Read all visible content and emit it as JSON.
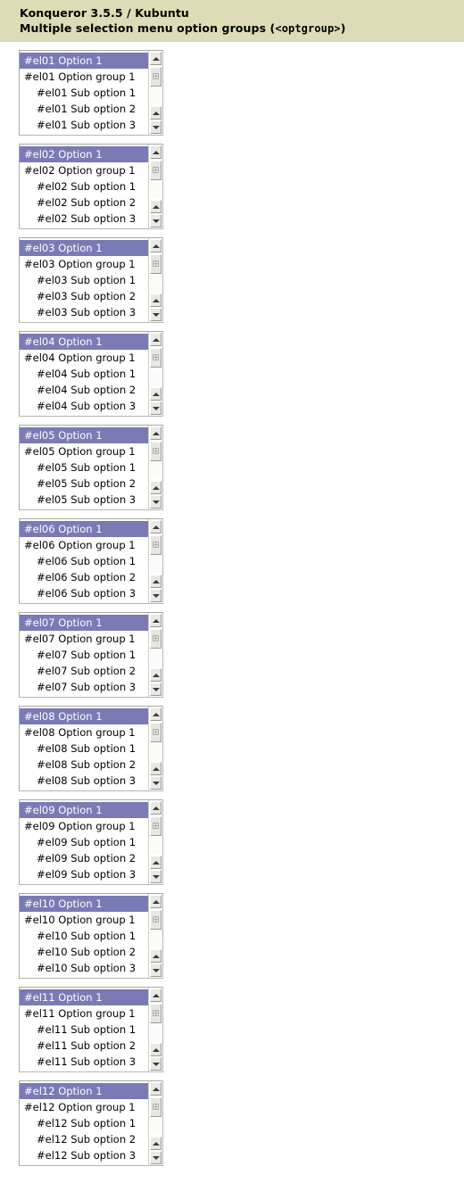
{
  "header": {
    "line1": "Konqueror 3.5.5 / Kubuntu",
    "line2_prefix": "Multiple selection menu option groups (",
    "line2_tag": "<optgroup>",
    "line2_suffix": ")",
    "background_color": "#dddcb6",
    "text_color": "#000000"
  },
  "colors": {
    "selection_background": "#7a7ab5",
    "selection_text": "#ffffff",
    "listbox_background": "#ffffff",
    "listbox_border": "#b5b5b0",
    "scrollbar_button": "#e8e8e4",
    "page_background": "#ffffff"
  },
  "scrollbar": {
    "up_arrow_icon": "triangle-up-icon",
    "down_arrow_icon": "triangle-down-icon",
    "thumb_grip_icon": "grip-dots-icon"
  },
  "listboxes": [
    {
      "id": "el01",
      "options": [
        {
          "label": "#el01 Option 1",
          "selected": true,
          "sub": false
        },
        {
          "label": "#el01 Option group 1",
          "selected": false,
          "sub": false
        },
        {
          "label": "#el01 Sub option 1",
          "selected": false,
          "sub": true
        },
        {
          "label": "#el01 Sub option 2",
          "selected": false,
          "sub": true
        },
        {
          "label": "#el01 Sub option 3",
          "selected": false,
          "sub": true
        }
      ]
    },
    {
      "id": "el02",
      "options": [
        {
          "label": "#el02 Option 1",
          "selected": true,
          "sub": false
        },
        {
          "label": "#el02 Option group 1",
          "selected": false,
          "sub": false
        },
        {
          "label": "#el02 Sub option 1",
          "selected": false,
          "sub": true
        },
        {
          "label": "#el02 Sub option 2",
          "selected": false,
          "sub": true
        },
        {
          "label": "#el02 Sub option 3",
          "selected": false,
          "sub": true
        }
      ]
    },
    {
      "id": "el03",
      "options": [
        {
          "label": "#el03 Option 1",
          "selected": true,
          "sub": false
        },
        {
          "label": "#el03 Option group 1",
          "selected": false,
          "sub": false
        },
        {
          "label": "#el03 Sub option 1",
          "selected": false,
          "sub": true
        },
        {
          "label": "#el03 Sub option 2",
          "selected": false,
          "sub": true
        },
        {
          "label": "#el03 Sub option 3",
          "selected": false,
          "sub": true
        }
      ]
    },
    {
      "id": "el04",
      "options": [
        {
          "label": "#el04 Option 1",
          "selected": true,
          "sub": false
        },
        {
          "label": "#el04 Option group 1",
          "selected": false,
          "sub": false
        },
        {
          "label": "#el04 Sub option 1",
          "selected": false,
          "sub": true
        },
        {
          "label": "#el04 Sub option 2",
          "selected": false,
          "sub": true
        },
        {
          "label": "#el04 Sub option 3",
          "selected": false,
          "sub": true
        }
      ]
    },
    {
      "id": "el05",
      "options": [
        {
          "label": "#el05 Option 1",
          "selected": true,
          "sub": false
        },
        {
          "label": "#el05 Option group 1",
          "selected": false,
          "sub": false
        },
        {
          "label": "#el05 Sub option 1",
          "selected": false,
          "sub": true
        },
        {
          "label": "#el05 Sub option 2",
          "selected": false,
          "sub": true
        },
        {
          "label": "#el05 Sub option 3",
          "selected": false,
          "sub": true
        }
      ]
    },
    {
      "id": "el06",
      "options": [
        {
          "label": "#el06 Option 1",
          "selected": true,
          "sub": false
        },
        {
          "label": "#el06 Option group 1",
          "selected": false,
          "sub": false
        },
        {
          "label": "#el06 Sub option 1",
          "selected": false,
          "sub": true
        },
        {
          "label": "#el06 Sub option 2",
          "selected": false,
          "sub": true
        },
        {
          "label": "#el06 Sub option 3",
          "selected": false,
          "sub": true
        }
      ]
    },
    {
      "id": "el07",
      "options": [
        {
          "label": "#el07 Option 1",
          "selected": true,
          "sub": false
        },
        {
          "label": "#el07 Option group 1",
          "selected": false,
          "sub": false
        },
        {
          "label": "#el07 Sub option 1",
          "selected": false,
          "sub": true
        },
        {
          "label": "#el07 Sub option 2",
          "selected": false,
          "sub": true
        },
        {
          "label": "#el07 Sub option 3",
          "selected": false,
          "sub": true
        }
      ]
    },
    {
      "id": "el08",
      "options": [
        {
          "label": "#el08 Option 1",
          "selected": true,
          "sub": false
        },
        {
          "label": "#el08 Option group 1",
          "selected": false,
          "sub": false
        },
        {
          "label": "#el08 Sub option 1",
          "selected": false,
          "sub": true
        },
        {
          "label": "#el08 Sub option 2",
          "selected": false,
          "sub": true
        },
        {
          "label": "#el08 Sub option 3",
          "selected": false,
          "sub": true
        }
      ]
    },
    {
      "id": "el09",
      "options": [
        {
          "label": "#el09 Option 1",
          "selected": true,
          "sub": false
        },
        {
          "label": "#el09 Option group 1",
          "selected": false,
          "sub": false
        },
        {
          "label": "#el09 Sub option 1",
          "selected": false,
          "sub": true
        },
        {
          "label": "#el09 Sub option 2",
          "selected": false,
          "sub": true
        },
        {
          "label": "#el09 Sub option 3",
          "selected": false,
          "sub": true
        }
      ]
    },
    {
      "id": "el10",
      "options": [
        {
          "label": "#el10 Option 1",
          "selected": true,
          "sub": false
        },
        {
          "label": "#el10 Option group 1",
          "selected": false,
          "sub": false
        },
        {
          "label": "#el10 Sub option 1",
          "selected": false,
          "sub": true
        },
        {
          "label": "#el10 Sub option 2",
          "selected": false,
          "sub": true
        },
        {
          "label": "#el10 Sub option 3",
          "selected": false,
          "sub": true
        }
      ]
    },
    {
      "id": "el11",
      "options": [
        {
          "label": "#el11 Option 1",
          "selected": true,
          "sub": false
        },
        {
          "label": "#el11 Option group 1",
          "selected": false,
          "sub": false
        },
        {
          "label": "#el11 Sub option 1",
          "selected": false,
          "sub": true
        },
        {
          "label": "#el11 Sub option 2",
          "selected": false,
          "sub": true
        },
        {
          "label": "#el11 Sub option 3",
          "selected": false,
          "sub": true
        }
      ]
    },
    {
      "id": "el12",
      "options": [
        {
          "label": "#el12 Option 1",
          "selected": true,
          "sub": false
        },
        {
          "label": "#el12 Option group 1",
          "selected": false,
          "sub": false
        },
        {
          "label": "#el12 Sub option 1",
          "selected": false,
          "sub": true
        },
        {
          "label": "#el12 Sub option 2",
          "selected": false,
          "sub": true
        },
        {
          "label": "#el12 Sub option 3",
          "selected": false,
          "sub": true
        }
      ]
    }
  ]
}
